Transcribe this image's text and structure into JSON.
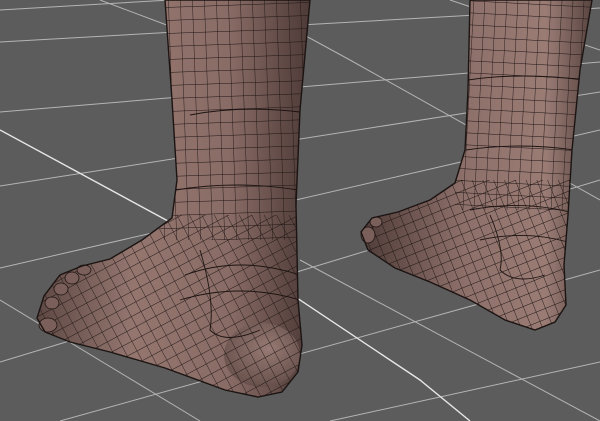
{
  "viewport": {
    "background": "#5c5c5c",
    "grid_color": "#b4b4b4",
    "grid_highlight_color": "#e6e6e6",
    "skin_color": "#8f706b",
    "skin_shadow": "#54413e",
    "skin_highlight": "#b0928c",
    "wire_color": "#1c1412"
  },
  "scene": {
    "objects": [
      "ground-grid",
      "right-leg",
      "left-leg"
    ]
  }
}
